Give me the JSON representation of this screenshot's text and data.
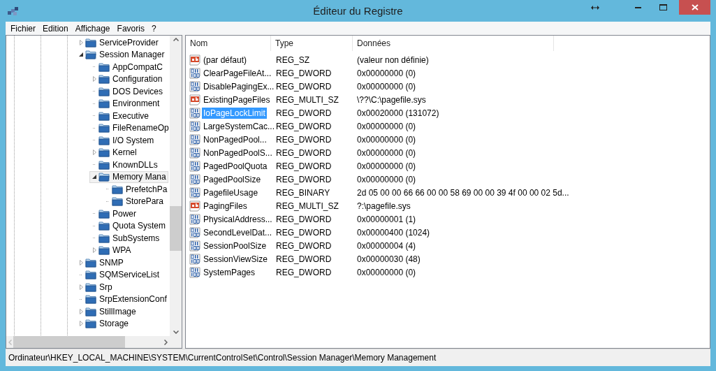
{
  "window": {
    "title": "Éditeur du Registre"
  },
  "menu": [
    "Fichier",
    "Edition",
    "Affichage",
    "Favoris",
    "?"
  ],
  "tree": [
    {
      "name": "ServiceProvider",
      "has_children": true,
      "expanded": false,
      "selected": false
    },
    {
      "name": "Session Manager",
      "has_children": true,
      "expanded": true,
      "selected": false,
      "children": [
        {
          "name": "AppCompatC",
          "has_children": false,
          "expanded": false,
          "selected": false
        },
        {
          "name": "Configuration",
          "has_children": true,
          "expanded": false,
          "selected": false
        },
        {
          "name": "DOS Devices",
          "has_children": false,
          "expanded": false,
          "selected": false
        },
        {
          "name": "Environment",
          "has_children": false,
          "expanded": false,
          "selected": false
        },
        {
          "name": "Executive",
          "has_children": false,
          "expanded": false,
          "selected": false
        },
        {
          "name": "FileRenameOp",
          "has_children": false,
          "expanded": false,
          "selected": false
        },
        {
          "name": "I/O System",
          "has_children": false,
          "expanded": false,
          "selected": false
        },
        {
          "name": "Kernel",
          "has_children": true,
          "expanded": false,
          "selected": false
        },
        {
          "name": "KnownDLLs",
          "has_children": false,
          "expanded": false,
          "selected": false
        },
        {
          "name": "Memory Mana",
          "has_children": true,
          "expanded": true,
          "selected": true,
          "children": [
            {
              "name": "PrefetchPa",
              "has_children": false,
              "expanded": false,
              "selected": false
            },
            {
              "name": "StorePara",
              "has_children": false,
              "expanded": false,
              "selected": false
            }
          ]
        },
        {
          "name": "Power",
          "has_children": false,
          "expanded": false,
          "selected": false
        },
        {
          "name": "Quota System",
          "has_children": false,
          "expanded": false,
          "selected": false
        },
        {
          "name": "SubSystems",
          "has_children": false,
          "expanded": false,
          "selected": false
        },
        {
          "name": "WPA",
          "has_children": true,
          "expanded": false,
          "selected": false
        }
      ]
    },
    {
      "name": "SNMP",
      "has_children": true,
      "expanded": false,
      "selected": false
    },
    {
      "name": "SQMServiceList",
      "has_children": false,
      "expanded": false,
      "selected": false
    },
    {
      "name": "Srp",
      "has_children": true,
      "expanded": false,
      "selected": false
    },
    {
      "name": "SrpExtensionConf",
      "has_children": false,
      "expanded": false,
      "selected": false
    },
    {
      "name": "StillImage",
      "has_children": true,
      "expanded": false,
      "selected": false
    },
    {
      "name": "Storage",
      "has_children": true,
      "expanded": false,
      "selected": false
    }
  ],
  "list": {
    "columns": [
      "Nom",
      "Type",
      "Données"
    ],
    "rows": [
      {
        "kind": "string",
        "name": "(par défaut)",
        "type": "REG_SZ",
        "data": "(valeur non définie)",
        "selected": false
      },
      {
        "kind": "binary",
        "name": "ClearPageFileAt...",
        "type": "REG_DWORD",
        "data": "0x00000000 (0)",
        "selected": false
      },
      {
        "kind": "binary",
        "name": "DisablePagingEx...",
        "type": "REG_DWORD",
        "data": "0x00000000 (0)",
        "selected": false
      },
      {
        "kind": "string",
        "name": "ExistingPageFiles",
        "type": "REG_MULTI_SZ",
        "data": "\\??\\C:\\pagefile.sys",
        "selected": false
      },
      {
        "kind": "binary",
        "name": "IoPageLockLimit",
        "type": "REG_DWORD",
        "data": "0x00020000 (131072)",
        "selected": true
      },
      {
        "kind": "binary",
        "name": "LargeSystemCac...",
        "type": "REG_DWORD",
        "data": "0x00000000 (0)",
        "selected": false
      },
      {
        "kind": "binary",
        "name": "NonPagedPool...",
        "type": "REG_DWORD",
        "data": "0x00000000 (0)",
        "selected": false
      },
      {
        "kind": "binary",
        "name": "NonPagedPoolS...",
        "type": "REG_DWORD",
        "data": "0x00000000 (0)",
        "selected": false
      },
      {
        "kind": "binary",
        "name": "PagedPoolQuota",
        "type": "REG_DWORD",
        "data": "0x00000000 (0)",
        "selected": false
      },
      {
        "kind": "binary",
        "name": "PagedPoolSize",
        "type": "REG_DWORD",
        "data": "0x00000000 (0)",
        "selected": false
      },
      {
        "kind": "binary",
        "name": "PagefileUsage",
        "type": "REG_BINARY",
        "data": "2d 05 00 00 66 66 00 00 58 69 00 00 39 4f 00 00 02 5d...",
        "selected": false
      },
      {
        "kind": "string",
        "name": "PagingFiles",
        "type": "REG_MULTI_SZ",
        "data": "?:\\pagefile.sys",
        "selected": false
      },
      {
        "kind": "binary",
        "name": "PhysicalAddress...",
        "type": "REG_DWORD",
        "data": "0x00000001 (1)",
        "selected": false
      },
      {
        "kind": "binary",
        "name": "SecondLevelDat...",
        "type": "REG_DWORD",
        "data": "0x00000400 (1024)",
        "selected": false
      },
      {
        "kind": "binary",
        "name": "SessionPoolSize",
        "type": "REG_DWORD",
        "data": "0x00000004 (4)",
        "selected": false
      },
      {
        "kind": "binary",
        "name": "SessionViewSize",
        "type": "REG_DWORD",
        "data": "0x00000030 (48)",
        "selected": false
      },
      {
        "kind": "binary",
        "name": "SystemPages",
        "type": "REG_DWORD",
        "data": "0x00000000 (0)",
        "selected": false
      }
    ]
  },
  "status_bar": "Ordinateur\\HKEY_LOCAL_MACHINE\\SYSTEM\\CurrentControlSet\\Control\\Session Manager\\Memory Management"
}
